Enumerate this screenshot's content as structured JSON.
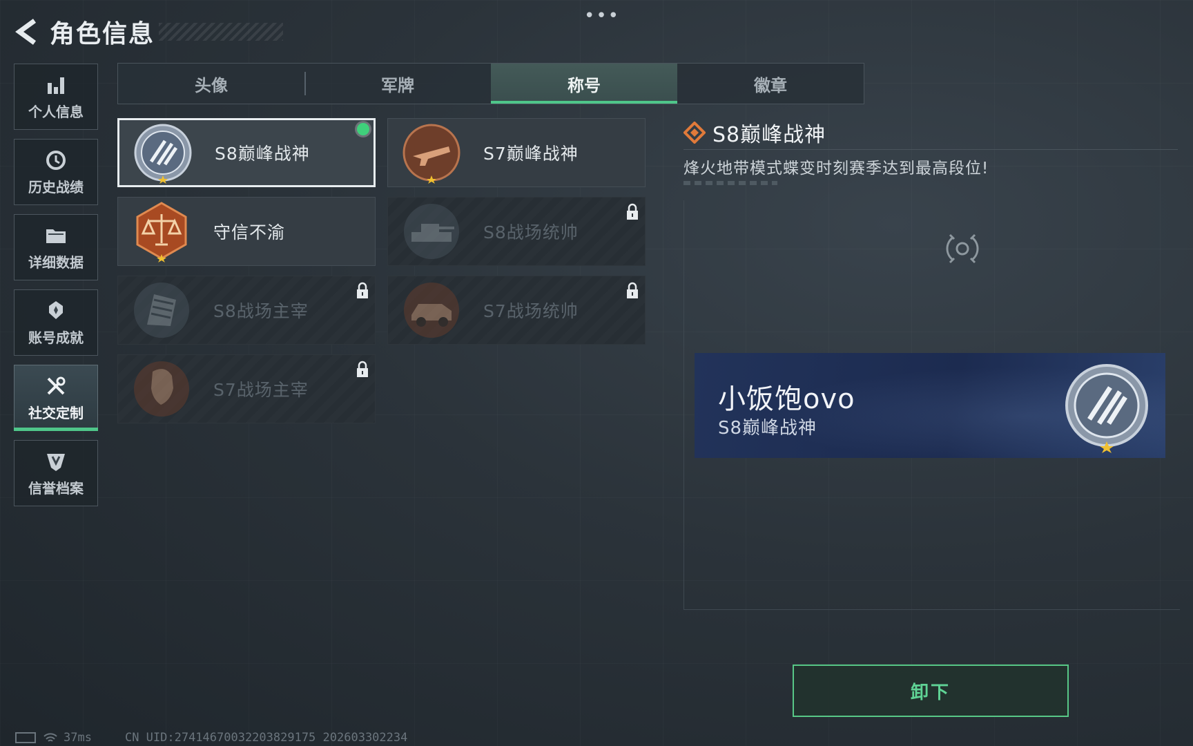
{
  "header": {
    "title": "角色信息",
    "more_label": "•••"
  },
  "sidebar": {
    "items": [
      {
        "label": "个人信息",
        "icon": "bar-chart-icon"
      },
      {
        "label": "历史战绩",
        "icon": "history-icon"
      },
      {
        "label": "详细数据",
        "icon": "folder-icon"
      },
      {
        "label": "账号成就",
        "icon": "medal-icon"
      },
      {
        "label": "社交定制",
        "icon": "tools-icon",
        "active": true
      },
      {
        "label": "信誉档案",
        "icon": "shield-icon"
      }
    ]
  },
  "tabs": [
    {
      "label": "头像"
    },
    {
      "label": "军牌"
    },
    {
      "label": "称号",
      "active": true
    },
    {
      "label": "徽章"
    }
  ],
  "titles": [
    {
      "name": "S8巅峰战神",
      "selected": true,
      "equipped": true,
      "locked": false,
      "badge": "silver-wings-badge-icon"
    },
    {
      "name": "S7巅峰战神",
      "selected": false,
      "locked": false,
      "badge": "bronze-gun-badge-icon"
    },
    {
      "name": "守信不渝",
      "selected": false,
      "locked": false,
      "badge": "scales-badge-icon"
    },
    {
      "name": "S8战场统帅",
      "selected": false,
      "locked": true,
      "badge": "tank-badge-icon"
    },
    {
      "name": "S8战场主宰",
      "selected": false,
      "locked": true,
      "badge": "building-badge-icon"
    },
    {
      "name": "S7战场统帅",
      "selected": false,
      "locked": true,
      "badge": "vehicle-badge-icon"
    },
    {
      "name": "S7战场主宰",
      "selected": false,
      "locked": true,
      "badge": "soldier-badge-icon"
    }
  ],
  "detail": {
    "title": "S8巅峰战神",
    "description": "烽火地带模式蝶变时刻赛季达到最高段位!"
  },
  "namecard": {
    "player_name": "小饭饱ovo",
    "title": "S8巅峰战神"
  },
  "unequip_label": "卸下",
  "status": {
    "ping": "37ms",
    "uid": "CN UID:274146700322038​29175  202603302234"
  },
  "colors": {
    "accent": "#4fc68a",
    "namecard_bg": "#1c2b50",
    "detail_icon": "#e07a3a"
  }
}
